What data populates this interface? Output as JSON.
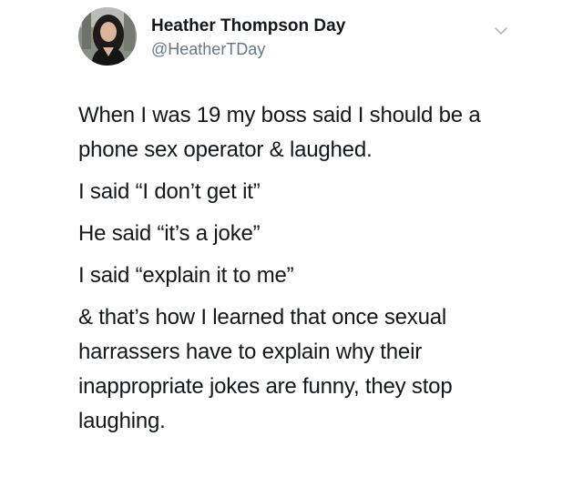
{
  "author": {
    "display_name": "Heather Thompson Day",
    "handle": "@HeatherTDay",
    "avatar_icon": "profile-photo",
    "menu_icon": "chevron-down-icon"
  },
  "tweet": {
    "paragraphs": [
      "When I was 19 my boss said I should be a phone sex operator & laughed.",
      "I said “I don’t get it”",
      "He said “it’s a joke”",
      "I said “explain it to me”",
      "& that’s how I learned that once sexual harrassers have to explain why their inappropriate jokes are funny, they stop laughing."
    ]
  },
  "colors": {
    "text": "#14171a",
    "secondary_text": "#657786",
    "chevron": "#aab8c2"
  }
}
